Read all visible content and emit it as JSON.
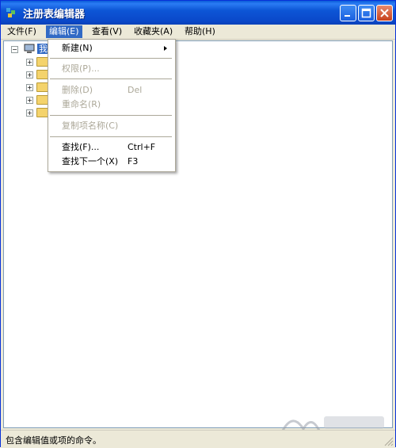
{
  "window": {
    "title": "注册表编辑器",
    "colors": {
      "title_bar": "#0a48c9",
      "menu_highlight": "#316ac5",
      "window_bg": "#ece9d8"
    }
  },
  "menubar": {
    "items": [
      {
        "label": "文件(F)"
      },
      {
        "label": "编辑(E)"
      },
      {
        "label": "查看(V)"
      },
      {
        "label": "收藏夹(A)"
      },
      {
        "label": "帮助(H)"
      }
    ]
  },
  "edit_menu": {
    "items": [
      {
        "label": "新建(N)",
        "shortcut": "",
        "disabled": false,
        "has_submenu": true
      },
      {
        "label": "权限(P)...",
        "shortcut": "",
        "disabled": true
      },
      {
        "label": "删除(D)",
        "shortcut": "Del",
        "disabled": true
      },
      {
        "label": "重命名(R)",
        "shortcut": "",
        "disabled": true
      },
      {
        "label": "复制项名称(C)",
        "shortcut": "",
        "disabled": true
      },
      {
        "label": "查找(F)...",
        "shortcut": "Ctrl+F",
        "disabled": false
      },
      {
        "label": "查找下一个(X)",
        "shortcut": "F3",
        "disabled": false
      }
    ]
  },
  "tree": {
    "root_label": "我"
  },
  "statusbar": {
    "text": "包含编辑值或项的命令。"
  }
}
